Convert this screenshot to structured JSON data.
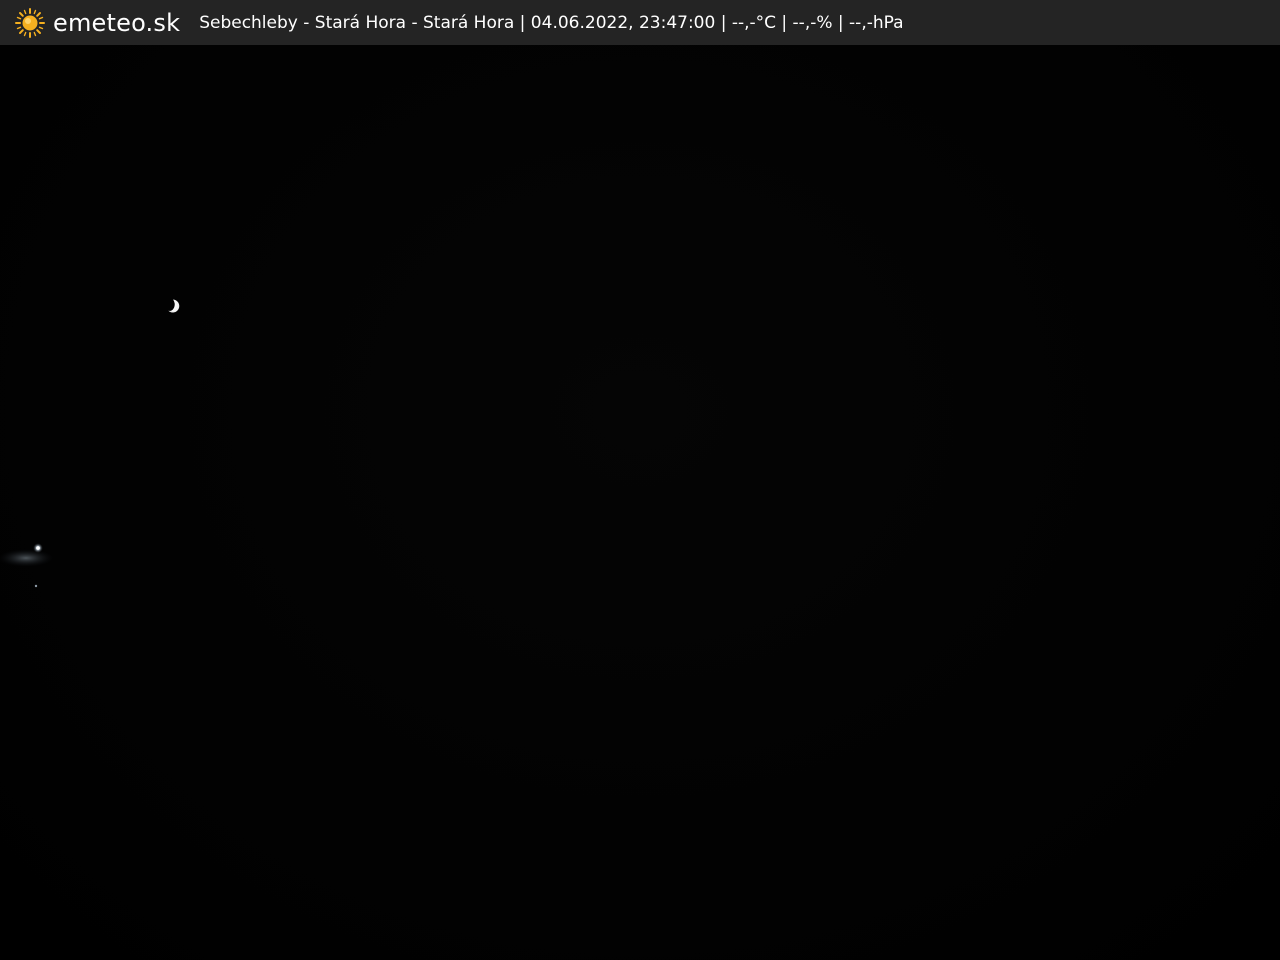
{
  "header": {
    "brand": "emeteo.sk",
    "brand_icon": "sun-icon",
    "brand_color": "#f5b020",
    "background": "#242424",
    "caption": "Sebechleby - Stará Hora - Stará Hora | 04.06.2022, 23:47:00 | --,-°C | --,-% | --,-hPa"
  },
  "scene": {
    "icons": [
      "moon-icon",
      "light-glow"
    ],
    "sky_color": "#010101"
  }
}
